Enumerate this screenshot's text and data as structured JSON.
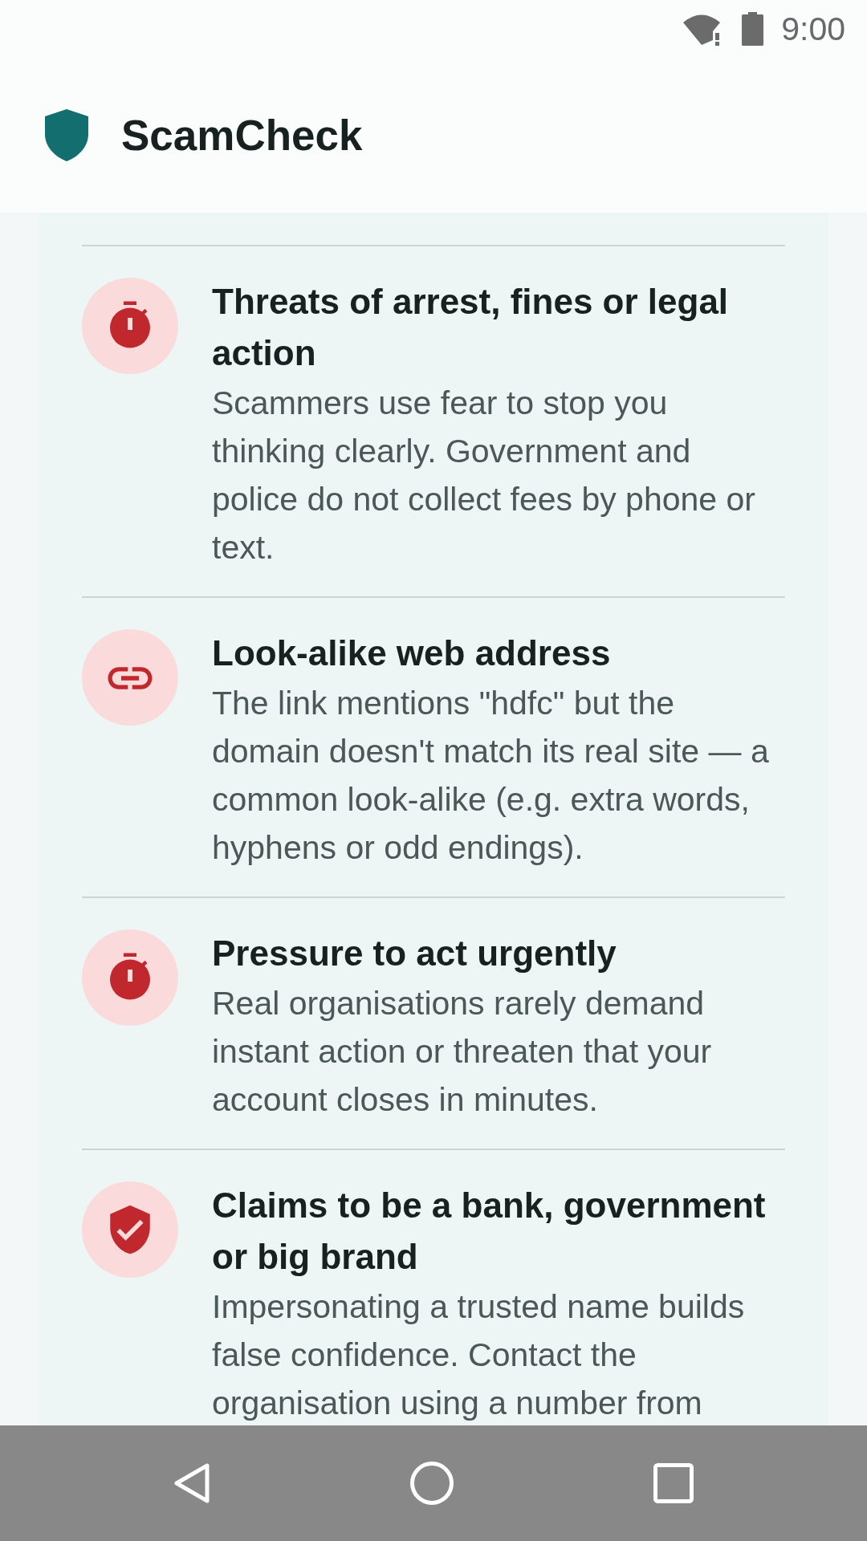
{
  "status_bar": {
    "time": "9:00"
  },
  "app_bar": {
    "title": "ScamCheck"
  },
  "warnings": [
    {
      "kind": "timer",
      "title": "Threats of arrest, fines or legal action",
      "description": "Scammers use fear to stop you thinking clearly. Government and police do not collect fees by phone or text."
    },
    {
      "kind": "link",
      "title": "Look-alike web address",
      "description": "The link mentions \"hdfc\" but the domain doesn't match its real site — a common look-alike (e.g. extra words, hyphens or odd endings)."
    },
    {
      "kind": "timer",
      "title": "Pressure to act urgently",
      "description": "Real organisations rarely demand instant action or threaten that your account closes in minutes."
    },
    {
      "kind": "shield",
      "title": "Claims to be a bank, government or big brand",
      "description": "Impersonating a trusted name builds false confidence. Contact the organisation using a number from"
    }
  ]
}
